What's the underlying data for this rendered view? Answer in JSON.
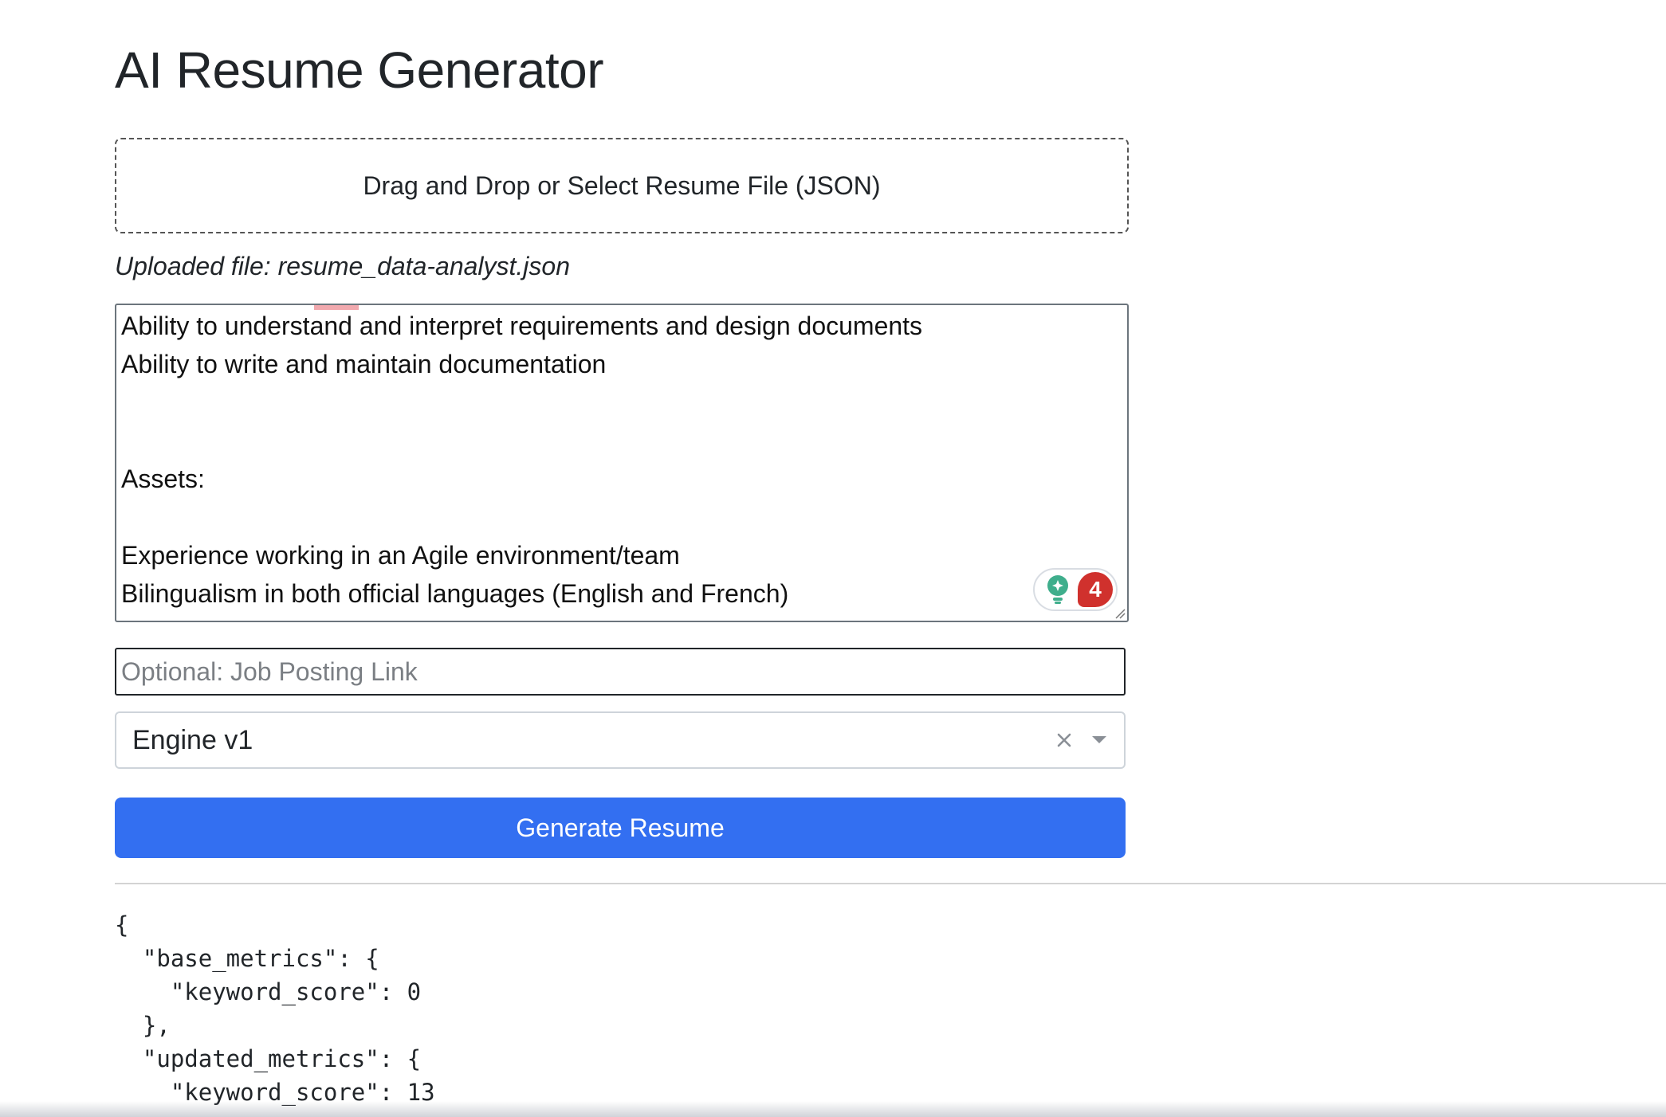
{
  "app": {
    "title": "AI Resume Generator"
  },
  "dropzone": {
    "label": "Drag and Drop or Select Resume File (JSON)"
  },
  "uploaded": {
    "text": "Uploaded file: resume_data-analyst.json"
  },
  "job_description": {
    "lines": [
      "Ability to understand and interpret requirements and design documents",
      "Ability to write and maintain documentation",
      "",
      "",
      "Assets:",
      "",
      "Experience working in an Agile environment/team",
      "Bilingualism in both official languages (English and French)"
    ],
    "grammar_issue_count": "4"
  },
  "job_link": {
    "placeholder": "Optional: Job Posting Link",
    "value": ""
  },
  "engine_select": {
    "selected": "Engine v1",
    "clear_icon": "close-icon",
    "caret_icon": "chevron-down-icon"
  },
  "generate": {
    "label": "Generate Resume"
  },
  "output": {
    "lines": [
      "{",
      "  \"base_metrics\": {",
      "    \"keyword_score\": 0",
      "  },",
      "  \"updated_metrics\": {",
      "    \"keyword_score\": 13"
    ]
  },
  "colors": {
    "primary": "#336ff1",
    "badge": "#d0312d",
    "bulb": "#3fae8c"
  }
}
